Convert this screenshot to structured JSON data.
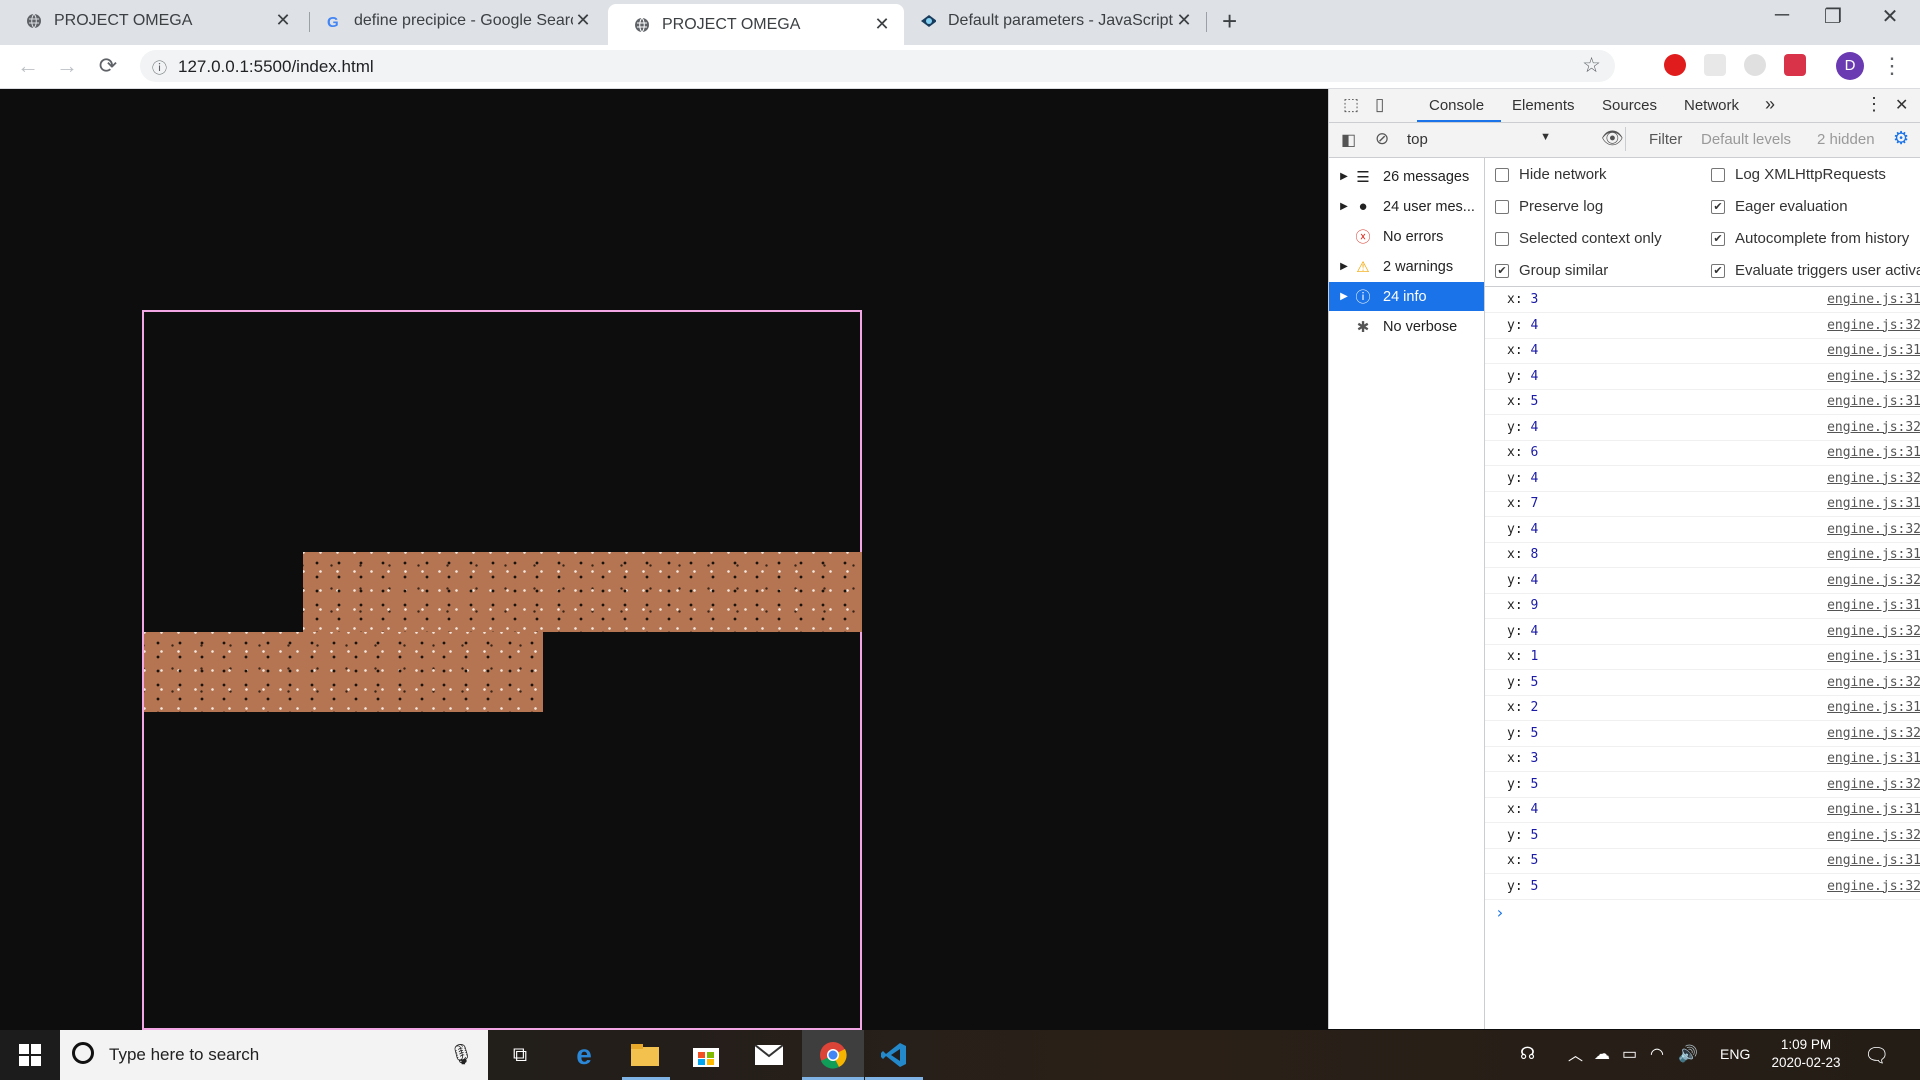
{
  "browser": {
    "tabs": [
      {
        "title": "PROJECT OMEGA",
        "icon": "globe-icon",
        "active": false
      },
      {
        "title": "define precipice - Google Search",
        "icon": "google-icon",
        "active": false
      },
      {
        "title": "PROJECT OMEGA",
        "icon": "globe-icon",
        "active": true
      },
      {
        "title": "Default parameters - JavaScript |",
        "icon": "mdn-icon",
        "active": false
      }
    ],
    "url": "127.0.0.1:5500/index.html",
    "profile_initial": "D"
  },
  "devtools": {
    "tabs": [
      "Console",
      "Elements",
      "Sources",
      "Network"
    ],
    "active_tab": "Console",
    "context": "top",
    "filter_placeholder": "Filter",
    "levels": "Default levels",
    "hidden": "2 hidden",
    "sidebar": [
      {
        "label": "26 messages",
        "icon": "list-icon",
        "expandable": true
      },
      {
        "label": "24 user mes...",
        "icon": "user-icon",
        "expandable": true
      },
      {
        "label": "No errors",
        "icon": "error-icon",
        "expandable": false
      },
      {
        "label": "2 warnings",
        "icon": "warning-icon",
        "expandable": true
      },
      {
        "label": "24 info",
        "icon": "info-icon",
        "expandable": true,
        "selected": true
      },
      {
        "label": "No verbose",
        "icon": "bug-icon",
        "expandable": false
      }
    ],
    "settings": [
      {
        "label": "Hide network",
        "checked": false
      },
      {
        "label": "Log XMLHttpRequests",
        "checked": false
      },
      {
        "label": "Preserve log",
        "checked": false
      },
      {
        "label": "Eager evaluation",
        "checked": true
      },
      {
        "label": "Selected context only",
        "checked": false
      },
      {
        "label": "Autocomplete from history",
        "checked": true
      },
      {
        "label": "Group similar",
        "checked": true
      },
      {
        "label": "Evaluate triggers user activa",
        "checked": true
      }
    ],
    "log": [
      {
        "key": "x:",
        "value": "3",
        "source": "engine.js:31"
      },
      {
        "key": "y:",
        "value": "4",
        "source": "engine.js:32"
      },
      {
        "key": "x:",
        "value": "4",
        "source": "engine.js:31"
      },
      {
        "key": "y:",
        "value": "4",
        "source": "engine.js:32"
      },
      {
        "key": "x:",
        "value": "5",
        "source": "engine.js:31"
      },
      {
        "key": "y:",
        "value": "4",
        "source": "engine.js:32"
      },
      {
        "key": "x:",
        "value": "6",
        "source": "engine.js:31"
      },
      {
        "key": "y:",
        "value": "4",
        "source": "engine.js:32"
      },
      {
        "key": "x:",
        "value": "7",
        "source": "engine.js:31"
      },
      {
        "key": "y:",
        "value": "4",
        "source": "engine.js:32"
      },
      {
        "key": "x:",
        "value": "8",
        "source": "engine.js:31"
      },
      {
        "key": "y:",
        "value": "4",
        "source": "engine.js:32"
      },
      {
        "key": "x:",
        "value": "9",
        "source": "engine.js:31"
      },
      {
        "key": "y:",
        "value": "4",
        "source": "engine.js:32"
      },
      {
        "key": "x:",
        "value": "1",
        "source": "engine.js:31"
      },
      {
        "key": "y:",
        "value": "5",
        "source": "engine.js:32"
      },
      {
        "key": "x:",
        "value": "2",
        "source": "engine.js:31"
      },
      {
        "key": "y:",
        "value": "5",
        "source": "engine.js:32"
      },
      {
        "key": "x:",
        "value": "3",
        "source": "engine.js:31"
      },
      {
        "key": "y:",
        "value": "5",
        "source": "engine.js:32"
      },
      {
        "key": "x:",
        "value": "4",
        "source": "engine.js:31"
      },
      {
        "key": "y:",
        "value": "5",
        "source": "engine.js:32"
      },
      {
        "key": "x:",
        "value": "5",
        "source": "engine.js:31"
      },
      {
        "key": "y:",
        "value": "5",
        "source": "engine.js:32"
      }
    ],
    "prompt": "›"
  },
  "taskbar": {
    "search_placeholder": "Type here to search",
    "language": "ENG",
    "time": "1:09 PM",
    "date": "2020-02-23"
  },
  "colors": {
    "canvas_border": "#f2a6e4",
    "dirt": "#b57552",
    "background": "#0d0d0d",
    "selected": "#1a73e8"
  }
}
